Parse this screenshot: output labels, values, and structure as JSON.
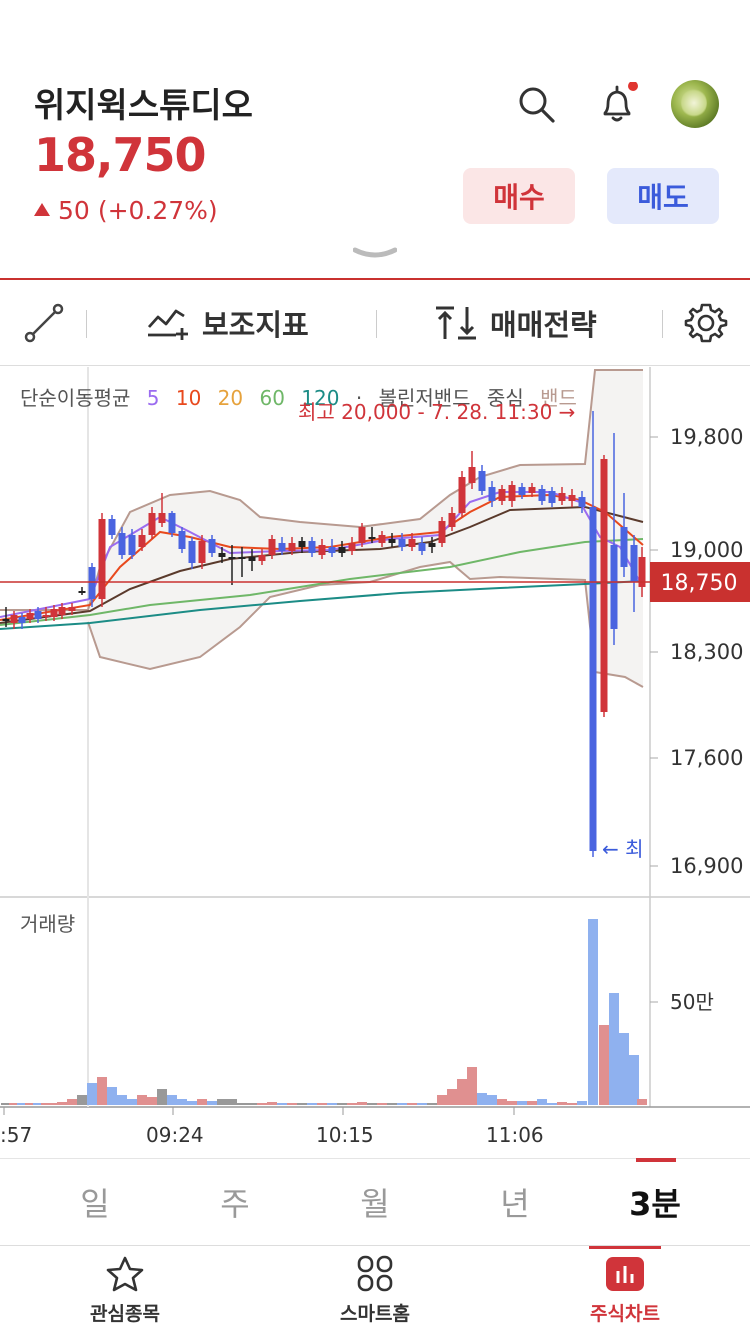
{
  "stock": {
    "name": "위지윅스튜디오",
    "price": "18,750",
    "change": "50",
    "change_pct": "(+0.27%)"
  },
  "actions": {
    "buy": "매수",
    "sell": "매도"
  },
  "toolbar": {
    "indicators": "보조지표",
    "strategy": "매매전략"
  },
  "chart": {
    "legend": {
      "ma_label": "단순이동평균",
      "ma_periods": [
        "5",
        "10",
        "20",
        "60",
        "120"
      ],
      "bb_label": "볼린저밴드",
      "bb_mid": "중심",
      "bb_band": "밴드",
      "colors": {
        "5": "#9b6cf0",
        "10": "#e8491d",
        "20": "#e6a23c",
        "60": "#6fb768",
        "120": "#1c8c86"
      }
    },
    "high_annotation": "최고 20,000 - 7. 28. 11:30 →",
    "low_annotation": "← 최",
    "y_ticks": [
      "19,800",
      "19,000",
      "18,300",
      "17,600",
      "16,900"
    ],
    "current_price_tag": "18,750",
    "volume_label": "거래량",
    "volume_tick": "50만",
    "x_ticks": [
      ":57",
      "09:24",
      "10:15",
      "11:06"
    ]
  },
  "chart_data": {
    "type": "candlestick",
    "interval": "3분",
    "ylim": [
      16900,
      20000
    ],
    "y_ticks": [
      19800,
      19000,
      18300,
      17600,
      16900
    ],
    "current_price": 18750,
    "high": 20000,
    "volume_ticks": [
      "50만"
    ],
    "x_ticks": [
      ":57",
      "09:24",
      "10:15",
      "11:06"
    ]
  },
  "period_tabs": [
    "일",
    "주",
    "월",
    "년",
    "3분"
  ],
  "bottom_nav": [
    "관심종목",
    "스마트홈",
    "주식차트"
  ]
}
